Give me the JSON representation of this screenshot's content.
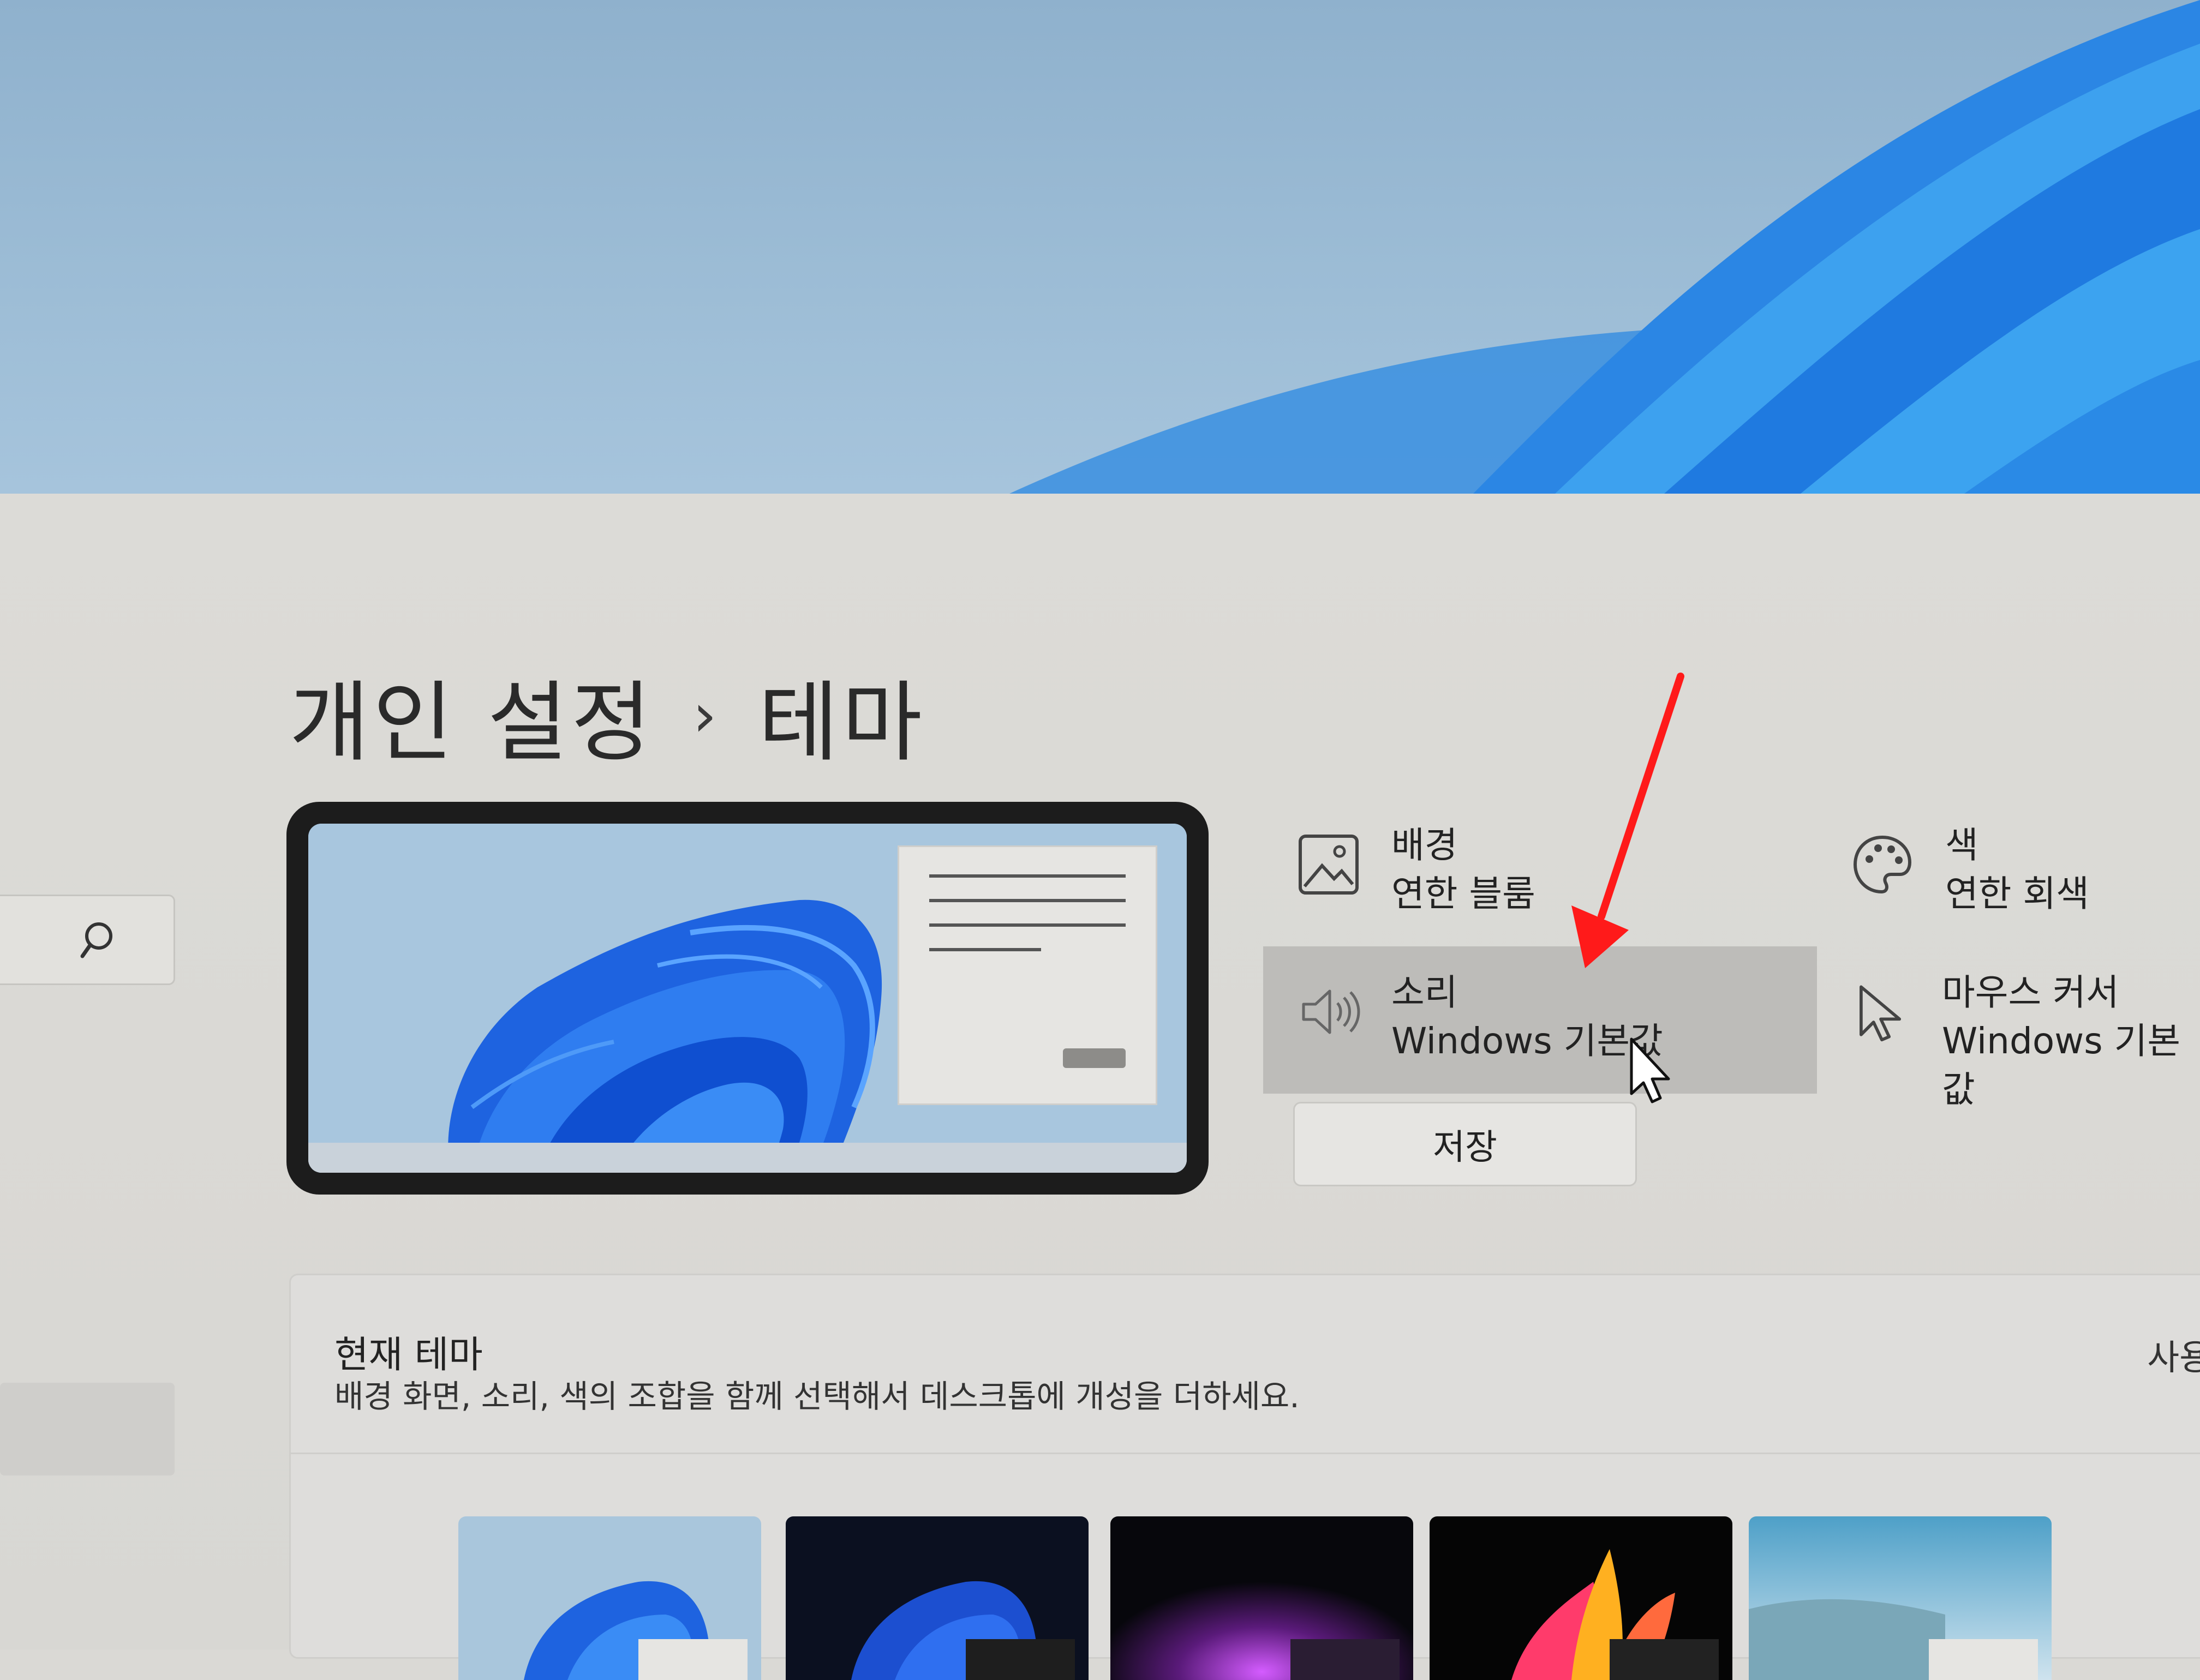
{
  "breadcrumb": {
    "parent": "개인 설정",
    "separator": "›",
    "current": "테마"
  },
  "tiles": {
    "background": {
      "title": "배경",
      "value": "연한 블룸",
      "icon": "image-icon"
    },
    "color": {
      "title": "색",
      "value": "연한 회색",
      "icon": "palette-icon"
    },
    "sound": {
      "title": "소리",
      "value": "Windows 기본값",
      "icon": "speaker-icon"
    },
    "cursor": {
      "title": "마우스 커서",
      "value": "Windows 기본값",
      "icon": "cursor-icon"
    }
  },
  "save_button": {
    "label": "저장"
  },
  "current_theme": {
    "title": "현재 테마",
    "description": "배경 화면, 소리, 색의 조합을 함께 선택해서 데스크톱에 개성을 더하세요.",
    "right_text": "사용"
  },
  "colors": {
    "annotation_arrow": "#ff1a1a",
    "accent_blue": "#1f73e8"
  }
}
